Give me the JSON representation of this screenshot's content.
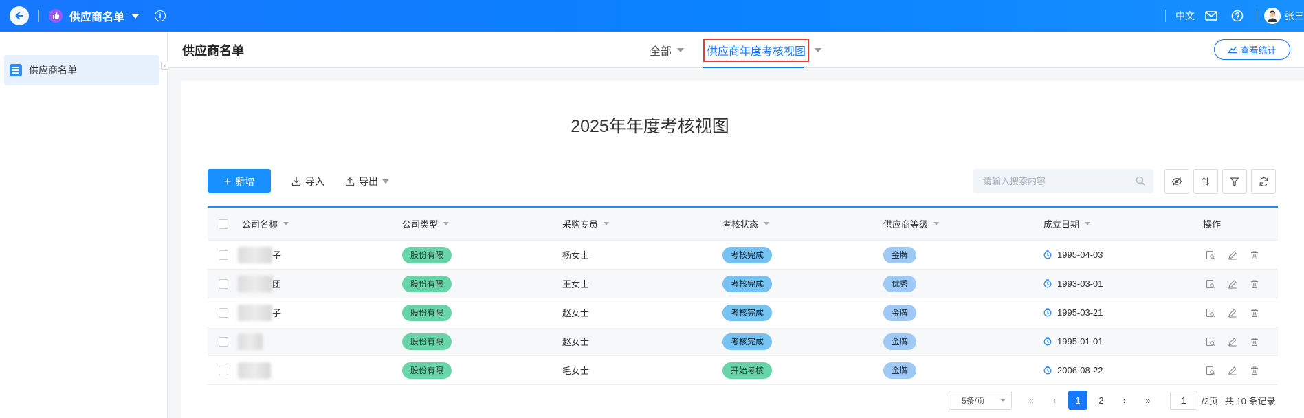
{
  "topbar": {
    "app_name": "供应商名单",
    "lang": "中文",
    "user": "张三"
  },
  "sidebar": {
    "items": [
      {
        "label": "供应商名单"
      }
    ]
  },
  "header": {
    "title": "供应商名单",
    "tabs": [
      {
        "label": "全部"
      },
      {
        "label": "供应商年度考核视图"
      }
    ],
    "stats_button": "查看统计"
  },
  "view": {
    "title": "2025年年度考核视图"
  },
  "toolbar": {
    "new_label": "新增",
    "import_label": "导入",
    "export_label": "导出",
    "search_placeholder": "请输入搜索内容"
  },
  "table": {
    "columns": [
      "公司名称",
      "公司类型",
      "采购专员",
      "考核状态",
      "供应商等级",
      "成立日期",
      "操作"
    ],
    "rows": [
      {
        "company_suffix": "子",
        "type": "股份有限",
        "buyer": "杨女士",
        "status": "考核完成",
        "level": "金牌",
        "date": "1995-04-03"
      },
      {
        "company_suffix": "团",
        "type": "股份有限",
        "buyer": "王女士",
        "status": "考核完成",
        "level": "优秀",
        "date": "1993-03-01"
      },
      {
        "company_suffix": "子",
        "type": "股份有限",
        "buyer": "赵女士",
        "status": "考核完成",
        "level": "金牌",
        "date": "1995-03-21"
      },
      {
        "company_suffix": "",
        "type": "股份有限",
        "buyer": "赵女士",
        "status": "考核完成",
        "level": "金牌",
        "date": "1995-01-01"
      },
      {
        "company_suffix": "",
        "type": "股份有限",
        "buyer": "毛女士",
        "status": "开始考核",
        "level": "金牌",
        "date": "2006-08-22"
      }
    ]
  },
  "pagination": {
    "page_size": "5条/页",
    "pages": [
      "1",
      "2"
    ],
    "current": "1",
    "jump_value": "1",
    "total_pages": "/2页",
    "total_records": "共 10 条记录"
  },
  "colors": {
    "primary": "#1677ff",
    "tag_green": "#67d5a8",
    "tag_blue": "#74c3f3",
    "tag_light_blue": "#9fcaf5",
    "highlight_border": "#e53935"
  }
}
